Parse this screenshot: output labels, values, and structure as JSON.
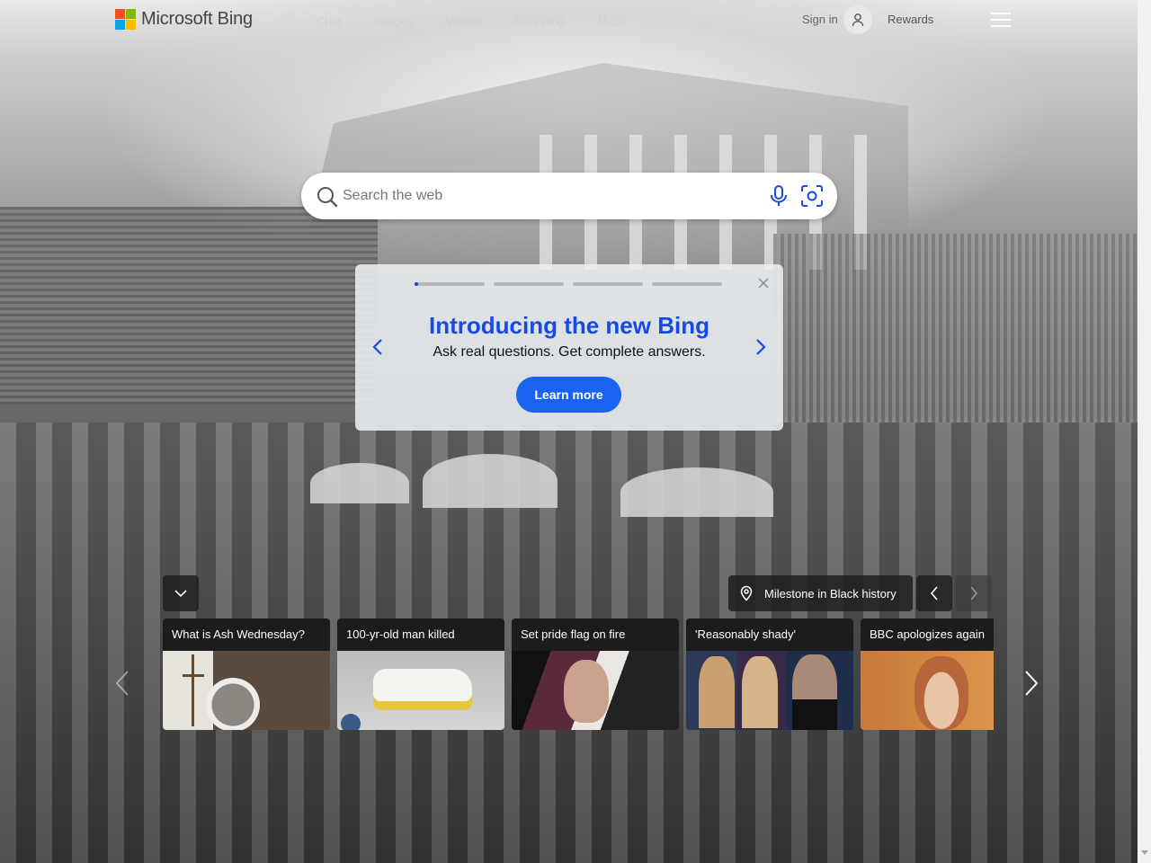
{
  "header": {
    "brand": "Microsoft Bing",
    "nav": [
      "Chat",
      "Images",
      "Videos",
      "Shopping",
      "Maps",
      "···"
    ],
    "sign_in": "Sign in",
    "rewards": "Rewards"
  },
  "search": {
    "placeholder": "Search the web"
  },
  "promo": {
    "title": "Introducing the new Bing",
    "subtitle": "Ask real questions. Get complete answers.",
    "button": "Learn more",
    "slides_total": 4,
    "active_slide": 1
  },
  "image_info": {
    "location_label": "Milestone in Black history"
  },
  "news": [
    {
      "title": "What is Ash Wednesday?"
    },
    {
      "title": "100-yr-old man killed"
    },
    {
      "title": "Set pride flag on fire"
    },
    {
      "title": "'Reasonably shady'"
    },
    {
      "title": "BBC apologizes again"
    }
  ],
  "colors": {
    "accent": "#174ae4",
    "button": "#1a63f0"
  }
}
